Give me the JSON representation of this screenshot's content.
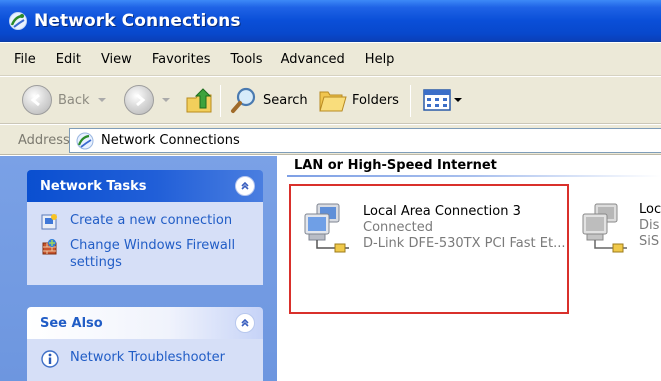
{
  "window": {
    "title": "Network Connections"
  },
  "menu": {
    "items": [
      {
        "id": "file",
        "label": "File"
      },
      {
        "id": "edit",
        "label": "Edit"
      },
      {
        "id": "view",
        "label": "View"
      },
      {
        "id": "favorites",
        "label": "Favorites"
      },
      {
        "id": "tools",
        "label": "Tools"
      },
      {
        "id": "advanced",
        "label": "Advanced"
      },
      {
        "id": "help",
        "label": "Help"
      }
    ]
  },
  "toolbar": {
    "back_label": "Back",
    "search_label": "Search",
    "folders_label": "Folders"
  },
  "address": {
    "label": "Address",
    "value": "Network Connections"
  },
  "task_pane": {
    "network_tasks": {
      "title": "Network Tasks",
      "items": [
        {
          "label": "Create a new connection",
          "icon": "new-connection-icon"
        },
        {
          "label": "Change Windows Firewall settings",
          "icon": "firewall-icon"
        }
      ]
    },
    "see_also": {
      "title": "See Also",
      "items": [
        {
          "label": "Network Troubleshooter",
          "icon": "info-icon"
        }
      ]
    }
  },
  "content": {
    "group_title": "LAN or High-Speed Internet",
    "connections": [
      {
        "name": "Local Area Connection 3",
        "status": "Connected",
        "device": "D-Link DFE-530TX PCI Fast Et...",
        "selected": true
      },
      {
        "name": "Loc",
        "status": "Dis",
        "device": "SiS",
        "selected": false
      }
    ]
  },
  "colors": {
    "titlebar": "#0a4fd8",
    "menubar": "#ece9d8",
    "task_pane_bg": "#7aa1e6",
    "task_link": "#215dc6",
    "selection_border": "#d9302b"
  }
}
